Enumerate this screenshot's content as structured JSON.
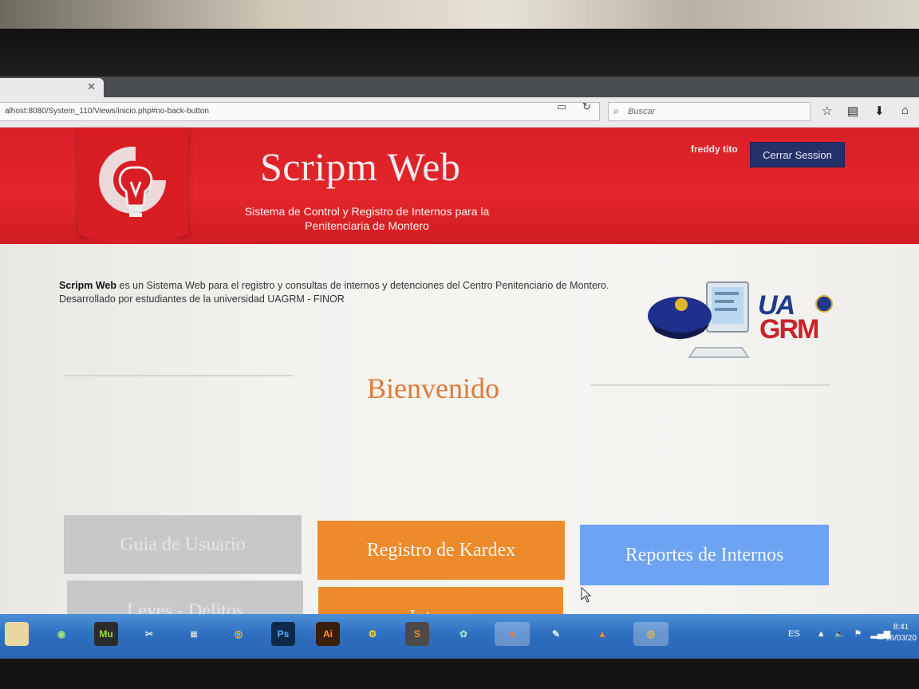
{
  "browser": {
    "url": "alhost:8080/System_110/Views/inicio.php#no-back-button",
    "search_placeholder": "Buscar"
  },
  "header": {
    "title": "Scripm Web",
    "subtitle_line1": "Sistema de Control y Registro de Internos para la",
    "subtitle_line2": "Penitenciaria de Montero",
    "user_name": "freddy tito",
    "logout_label": "Cerrar Session"
  },
  "intro": {
    "brand": "Scripm Web",
    "text": " es un Sistema Web para el registro y consultas de internos y detenciones del Centro Penitenciario de Montero. Desarrollado por estudiantes de la universidad UAGRM - FINOR"
  },
  "logos": {
    "uagrm_line1": "UA",
    "uagrm_line2": "GRM"
  },
  "welcome": "Bienvenido",
  "tiles": {
    "guia": "Guia de Usuario",
    "leyes": "Leyes - Delitos",
    "kardex": "Registro de Kardex",
    "internos": "Internos",
    "reportes": "Reportes de Internos"
  },
  "taskbar": {
    "apps": [
      "folder",
      "android-studio",
      "Mu",
      "tools",
      "database",
      "chrome",
      "Ps",
      "Ai",
      "python",
      "sublime",
      "app",
      "firefox",
      "inkscape",
      "vlc",
      "chrome"
    ],
    "language": "ES",
    "time": "8:41",
    "date": "16/03/20"
  },
  "colors": {
    "header_red": "#e3262a",
    "logout_blue": "#243169",
    "tile_gray": "#c8c8c8",
    "tile_orange": "#ec8a2c",
    "tile_blue": "#6da3f2",
    "welcome_orange": "#e07a38"
  }
}
